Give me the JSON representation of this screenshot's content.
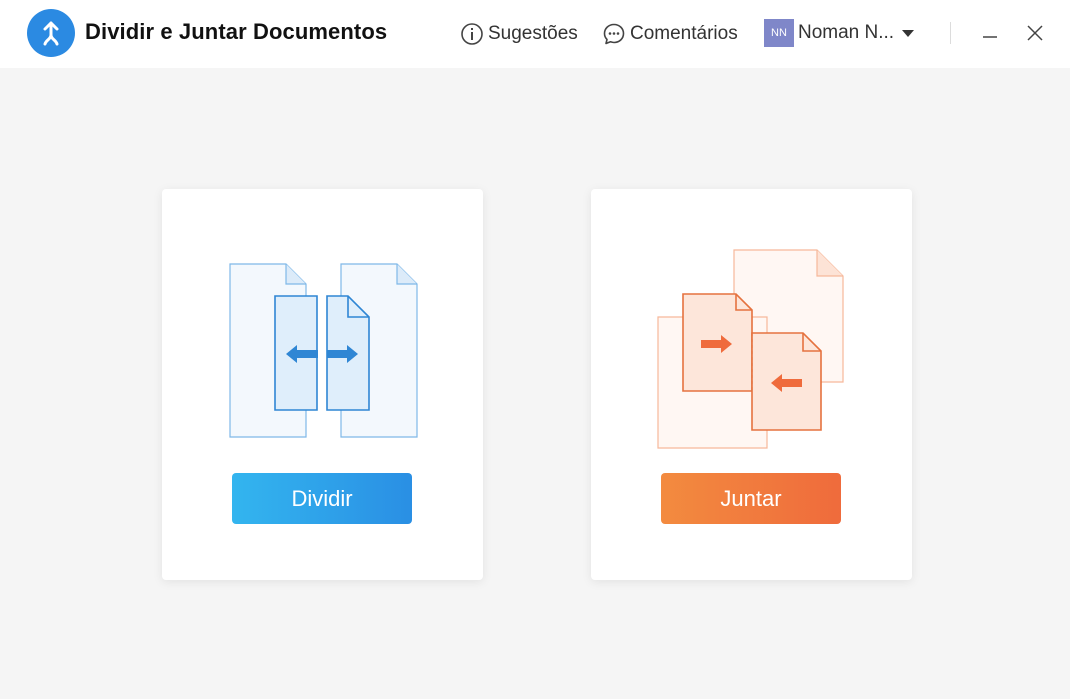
{
  "app": {
    "title": "Dividir e Juntar Documentos",
    "logo_icon": "split-merge-arrow-icon",
    "accent_color": "#2b8ae2"
  },
  "header": {
    "suggestions_label": "Sugestões",
    "suggestions_icon": "info-icon",
    "comments_label": "Comentários",
    "comments_icon": "chat-bubble-icon",
    "user": {
      "initials": "NN",
      "name": "Noman N...",
      "avatar_color": "#7f87c9"
    },
    "window_controls": [
      "minimize-icon",
      "close-icon"
    ]
  },
  "cards": {
    "split": {
      "button_label": "Dividir",
      "illustration": "split-document-icon",
      "color": "#2a8fe4"
    },
    "merge": {
      "button_label": "Juntar",
      "illustration": "merge-document-icon",
      "color": "#ef6b3c"
    }
  }
}
